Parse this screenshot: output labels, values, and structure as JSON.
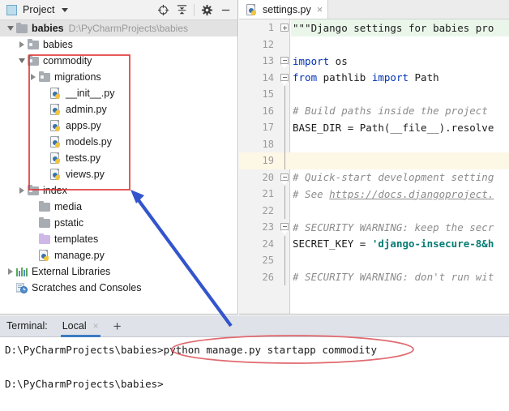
{
  "project_panel": {
    "title": "Project",
    "icon": "project-panel-icon",
    "toolbar": [
      {
        "name": "locate-icon",
        "glyph": "target"
      },
      {
        "name": "collapse-all-icon",
        "glyph": "collapse"
      },
      {
        "name": "settings-gear-icon",
        "glyph": "gear"
      },
      {
        "name": "hide-panel-icon",
        "glyph": "minus"
      }
    ],
    "tree": [
      {
        "label": "babies",
        "path": "D:\\PyCharmProjects\\babies",
        "icon": "folder-icon",
        "indent": 0,
        "twist": "down",
        "bold": true,
        "selected": true
      },
      {
        "label": "babies",
        "path": "",
        "icon": "module-folder-icon",
        "indent": 1,
        "twist": "right",
        "bold": false,
        "selected": false
      },
      {
        "label": "commodity",
        "path": "",
        "icon": "module-folder-icon",
        "indent": 1,
        "twist": "down",
        "bold": false,
        "selected": false
      },
      {
        "label": "migrations",
        "path": "",
        "icon": "module-folder-icon",
        "indent": 2,
        "twist": "right",
        "bold": false,
        "selected": false
      },
      {
        "label": "__init__.py",
        "path": "",
        "icon": "python-file-icon",
        "indent": 3,
        "twist": "none",
        "bold": false,
        "selected": false
      },
      {
        "label": "admin.py",
        "path": "",
        "icon": "python-file-icon",
        "indent": 3,
        "twist": "none",
        "bold": false,
        "selected": false
      },
      {
        "label": "apps.py",
        "path": "",
        "icon": "python-file-icon",
        "indent": 3,
        "twist": "none",
        "bold": false,
        "selected": false
      },
      {
        "label": "models.py",
        "path": "",
        "icon": "python-file-icon",
        "indent": 3,
        "twist": "none",
        "bold": false,
        "selected": false
      },
      {
        "label": "tests.py",
        "path": "",
        "icon": "python-file-icon",
        "indent": 3,
        "twist": "none",
        "bold": false,
        "selected": false
      },
      {
        "label": "views.py",
        "path": "",
        "icon": "python-file-icon",
        "indent": 3,
        "twist": "none",
        "bold": false,
        "selected": false
      },
      {
        "label": "index",
        "path": "",
        "icon": "module-folder-icon",
        "indent": 1,
        "twist": "right",
        "bold": false,
        "selected": false
      },
      {
        "label": "media",
        "path": "",
        "icon": "folder-icon",
        "indent": 2,
        "twist": "none",
        "bold": false,
        "selected": false
      },
      {
        "label": "pstatic",
        "path": "",
        "icon": "folder-icon",
        "indent": 2,
        "twist": "none",
        "bold": false,
        "selected": false
      },
      {
        "label": "templates",
        "path": "",
        "icon": "templates-folder-icon",
        "indent": 2,
        "twist": "none",
        "bold": false,
        "selected": false
      },
      {
        "label": "manage.py",
        "path": "",
        "icon": "python-file-icon",
        "indent": 2,
        "twist": "none",
        "bold": false,
        "selected": false
      },
      {
        "label": "External Libraries",
        "path": "",
        "icon": "external-libraries-icon",
        "indent": 0,
        "twist": "right",
        "bold": false,
        "selected": false
      },
      {
        "label": "Scratches and Consoles",
        "path": "",
        "icon": "scratches-icon",
        "indent": 0,
        "twist": "none",
        "bold": false,
        "selected": false
      }
    ]
  },
  "editor": {
    "tab": {
      "label": "settings.py",
      "icon": "python-file-icon",
      "close": "×"
    },
    "lines": [
      {
        "num": "1",
        "fold": "plus",
        "highlight": false,
        "docbg": true,
        "tokens": [
          {
            "t": "\"\"\"Django settings for babies pro",
            "c": "doc"
          }
        ]
      },
      {
        "num": "12",
        "fold": "none",
        "highlight": false,
        "docbg": false,
        "tokens": []
      },
      {
        "num": "13",
        "fold": "arrow",
        "highlight": false,
        "docbg": false,
        "tokens": [
          {
            "t": "import",
            "c": "kw"
          },
          {
            "t": " os",
            "c": "plain"
          }
        ]
      },
      {
        "num": "14",
        "fold": "arrow",
        "highlight": false,
        "docbg": false,
        "tokens": [
          {
            "t": "from",
            "c": "kw"
          },
          {
            "t": " pathlib ",
            "c": "plain"
          },
          {
            "t": "import",
            "c": "kw"
          },
          {
            "t": " Path",
            "c": "plain"
          }
        ]
      },
      {
        "num": "15",
        "fold": "tailv",
        "highlight": false,
        "docbg": false,
        "tokens": []
      },
      {
        "num": "16",
        "fold": "tailv",
        "highlight": false,
        "docbg": false,
        "tokens": [
          {
            "t": "# Build paths inside the project",
            "c": "cmt"
          }
        ]
      },
      {
        "num": "17",
        "fold": "tailv",
        "highlight": false,
        "docbg": false,
        "tokens": [
          {
            "t": "BASE_DIR = Path(__file__).resolve",
            "c": "plain"
          }
        ]
      },
      {
        "num": "18",
        "fold": "tailv",
        "highlight": false,
        "docbg": false,
        "tokens": []
      },
      {
        "num": "19",
        "fold": "tailv",
        "highlight": true,
        "docbg": false,
        "tokens": []
      },
      {
        "num": "20",
        "fold": "arrow",
        "highlight": false,
        "docbg": false,
        "tokens": [
          {
            "t": "# Quick-start development setting",
            "c": "cmt"
          }
        ]
      },
      {
        "num": "21",
        "fold": "tailv",
        "highlight": false,
        "docbg": false,
        "tokens": [
          {
            "t": "# See ",
            "c": "cmt"
          },
          {
            "t": "https://docs.djangoproject.",
            "c": "link"
          }
        ]
      },
      {
        "num": "22",
        "fold": "tailv",
        "highlight": false,
        "docbg": false,
        "tokens": []
      },
      {
        "num": "23",
        "fold": "arrow",
        "highlight": false,
        "docbg": false,
        "tokens": [
          {
            "t": "# SECURITY WARNING: keep the secr",
            "c": "cmt"
          }
        ]
      },
      {
        "num": "24",
        "fold": "tailv",
        "highlight": false,
        "docbg": false,
        "tokens": [
          {
            "t": "SECRET_KEY = ",
            "c": "plain"
          },
          {
            "t": "'django-insecure-8&h",
            "c": "str"
          }
        ]
      },
      {
        "num": "25",
        "fold": "tailv",
        "highlight": false,
        "docbg": false,
        "tokens": []
      },
      {
        "num": "26",
        "fold": "tailv",
        "highlight": false,
        "docbg": false,
        "tokens": [
          {
            "t": "# SECURITY WARNING: don't run wit",
            "c": "cmt"
          }
        ]
      }
    ]
  },
  "terminal": {
    "label": "Terminal:",
    "tab": "Local",
    "tab_close": "×",
    "add_tab": "+",
    "lines": [
      "D:\\PyCharmProjects\\babies>python manage.py startapp commodity",
      "",
      "D:\\PyCharmProjects\\babies>"
    ]
  },
  "annotations": {
    "box_color": "#e03030",
    "ellipse_color": "#e06a70",
    "arrow_color": "#3355cc"
  }
}
